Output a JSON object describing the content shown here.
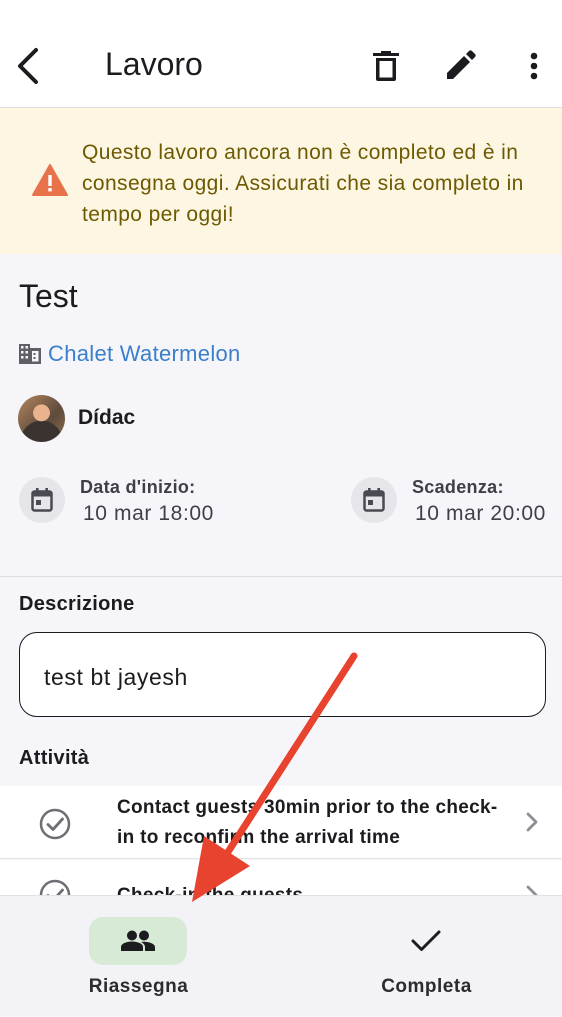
{
  "header": {
    "title": "Lavoro",
    "back_icon": "chevron-left-icon",
    "delete_icon": "trash-icon",
    "edit_icon": "pencil-icon",
    "more_icon": "more-vert-icon"
  },
  "warning": {
    "icon": "warning-triangle-icon",
    "text": "Questo lavoro ancora non è completo ed è in consegna oggi. Assicurati che sia completo in tempo per oggi!",
    "color": "#6d5a00",
    "background": "#fdf6e3"
  },
  "job": {
    "title": "Test",
    "property": "Chalet Watermelon",
    "assignee": "Dídac",
    "start_label": "Data d'inizio:",
    "start_value": "10 mar 18:00",
    "due_label": "Scadenza:",
    "due_value": "10 mar 20:00"
  },
  "description": {
    "label": "Descrizione",
    "value": "test bt jayesh"
  },
  "activities": {
    "label": "Attività",
    "items": [
      {
        "text": "Contact guests 30min prior to the check-in to reconfirm the arrival time"
      },
      {
        "text": "Check-in the guests"
      }
    ]
  },
  "bottom_nav": {
    "reassign_label": "Riassegna",
    "complete_label": "Completa",
    "active_color": "#d7ead6"
  },
  "annotation": {
    "arrow_color": "#e8432e"
  }
}
